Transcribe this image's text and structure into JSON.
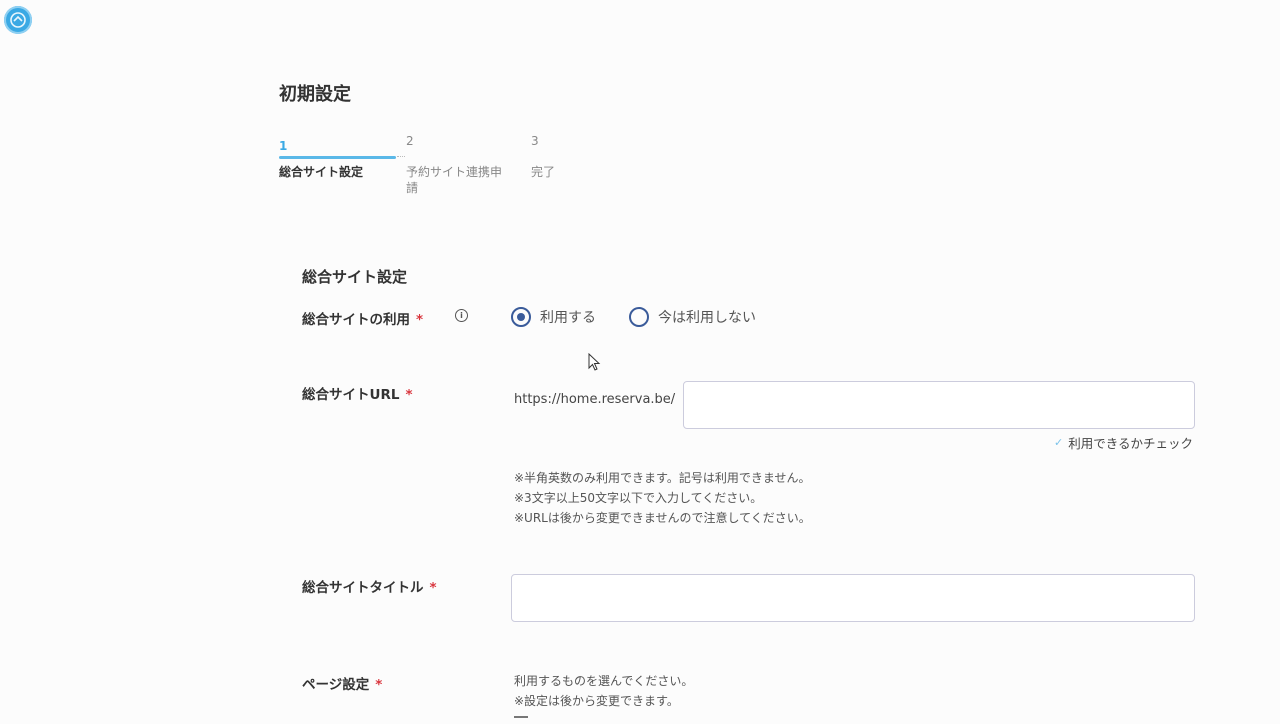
{
  "page": {
    "title": "初期設定"
  },
  "steps": [
    {
      "num": "1",
      "label": "総合サイト設定"
    },
    {
      "num": "2",
      "label": "予約サイト連携申請"
    },
    {
      "num": "3",
      "label": "完了"
    }
  ],
  "section": {
    "title": "総合サイト設定"
  },
  "fields": {
    "usage": {
      "label": "総合サイトの利用",
      "required_mark": "*",
      "info_glyph": "i",
      "options": [
        "利用する",
        "今は利用しない"
      ],
      "selected": "利用する"
    },
    "url": {
      "label": "総合サイトURL",
      "required_mark": "*",
      "prefix": "https://home.reserva.be/",
      "value": "",
      "check_label": "利用できるかチェック",
      "notes": [
        "※半角英数のみ利用できます。記号は利用できません。",
        "※3文字以上50文字以下で入力してください。",
        "※URLは後から変更できませんので注意してください。"
      ]
    },
    "site_title": {
      "label": "総合サイトタイトル",
      "required_mark": "*",
      "value": ""
    },
    "page_settings": {
      "label": "ページ設定",
      "required_mark": "*",
      "notes": [
        "利用するものを選んでください。",
        "※設定は後から変更できます。"
      ]
    }
  },
  "colors": {
    "accent": "#3aa9e4",
    "radio": "#3a5b9a",
    "required": "#d9363e"
  }
}
